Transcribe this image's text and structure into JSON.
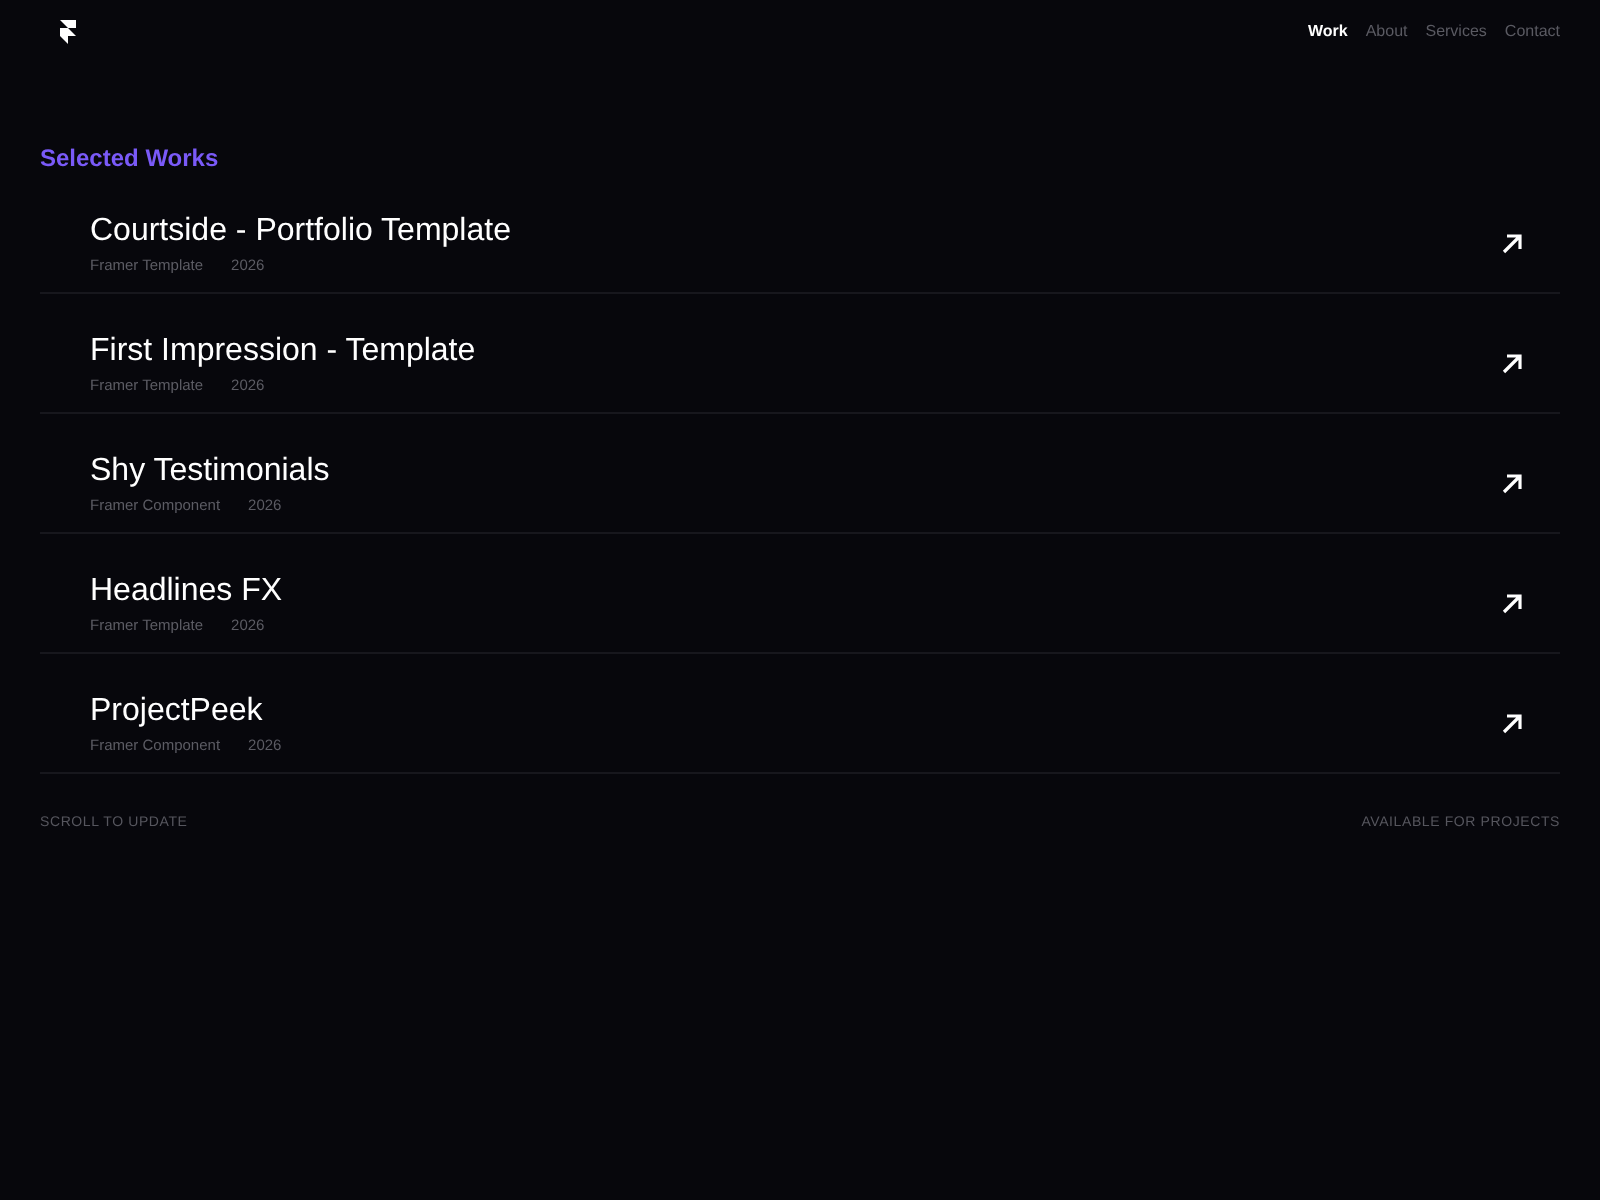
{
  "header": {
    "nav": [
      {
        "label": "Work",
        "selected": true
      },
      {
        "label": "About",
        "selected": false
      },
      {
        "label": "Services",
        "selected": false
      },
      {
        "label": "Contact",
        "selected": false
      }
    ]
  },
  "section": {
    "title": "Selected Works",
    "projects": [
      {
        "title": "Courtside - Portfolio Template",
        "type": "Framer Template",
        "year": "2026"
      },
      {
        "title": "First Impression - Template",
        "type": "Framer Template",
        "year": "2026"
      },
      {
        "title": "Shy Testimonials",
        "type": "Framer Component",
        "year": "2026"
      },
      {
        "title": "Headlines FX",
        "type": "Framer Template",
        "year": "2026"
      },
      {
        "title": "ProjectPeek",
        "type": "Framer Component",
        "year": "2026"
      }
    ]
  },
  "footer": {
    "left": "SCROLL TO UPDATE",
    "right": "AVAILABLE FOR PROJECTS"
  }
}
